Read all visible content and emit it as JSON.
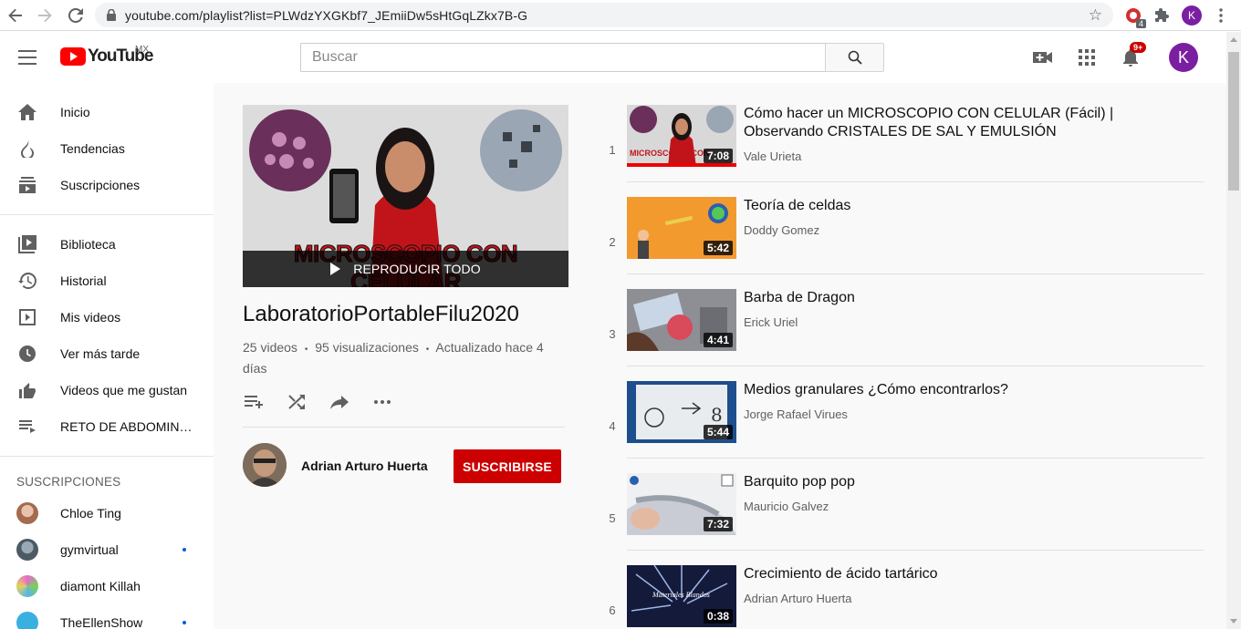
{
  "browser": {
    "url": "youtube.com/playlist?list=PLWdzYXGKbf7_JEmiiDw5sHtGqLZkx7B-G",
    "ext_badge": "4",
    "profile_initial": "K"
  },
  "header": {
    "logo_text": "YouTube",
    "region": "MX",
    "search_placeholder": "Buscar",
    "notif_count": "9+",
    "avatar_initial": "K"
  },
  "sidebar": {
    "main_items": [
      {
        "label": "Inicio",
        "icon": "home-icon"
      },
      {
        "label": "Tendencias",
        "icon": "flame-icon"
      },
      {
        "label": "Suscripciones",
        "icon": "subscriptions-icon"
      }
    ],
    "library_items": [
      {
        "label": "Biblioteca",
        "icon": "library-icon"
      },
      {
        "label": "Historial",
        "icon": "history-icon"
      },
      {
        "label": "Mis videos",
        "icon": "my-videos-icon"
      },
      {
        "label": "Ver más tarde",
        "icon": "clock-icon"
      },
      {
        "label": "Videos que me gustan",
        "icon": "thumbs-up-icon"
      },
      {
        "label": "RETO DE ABDOMINA...",
        "icon": "playlist-icon"
      }
    ],
    "subscriptions_heading": "SUSCRIPCIONES",
    "subscriptions": [
      {
        "name": "Chloe Ting",
        "new": false,
        "color": "#c9a08a"
      },
      {
        "name": "gymvirtual",
        "new": true,
        "color": "#6b7d8c"
      },
      {
        "name": "diamont Killah",
        "new": false,
        "color": "#9bc06a"
      },
      {
        "name": "TheEllenShow",
        "new": true,
        "color": "#3ab0e0"
      }
    ]
  },
  "playlist": {
    "play_all_label": "REPRODUCIR TODO",
    "thumb_text": "MICROSCOPIO CON CELULAR",
    "title": "LaboratorioPortableFilu2020",
    "video_count": "25 videos",
    "views": "95 visualizaciones",
    "updated": "Actualizado hace 4 días",
    "separator": "•",
    "owner_name": "Adrian Arturo Huerta",
    "subscribe_label": "SUSCRIBIRSE"
  },
  "videos": [
    {
      "index": "1",
      "title": "Cómo hacer un MICROSCOPIO CON CELULAR (Fácil) | Observando CRISTALES DE SAL Y EMULSIÓN",
      "channel": "Vale Urieta",
      "duration": "7:08",
      "thumb_text": "MICROSCOPIO CON"
    },
    {
      "index": "2",
      "title": "Teoría de celdas",
      "channel": "Doddy Gomez",
      "duration": "5:42"
    },
    {
      "index": "3",
      "title": "Barba de Dragon",
      "channel": "Erick Uriel",
      "duration": "4:41"
    },
    {
      "index": "4",
      "title": "Medios granulares ¿Cómo encontrarlos?",
      "channel": "Jorge Rafael Virues",
      "duration": "5:44"
    },
    {
      "index": "5",
      "title": "Barquito pop pop",
      "channel": "Mauricio Galvez",
      "duration": "7:32"
    },
    {
      "index": "6",
      "title": "Crecimiento de ácido tartárico",
      "channel": "Adrian Arturo Huerta",
      "duration": "0:38",
      "thumb_text": "Materiales Blandos"
    }
  ]
}
